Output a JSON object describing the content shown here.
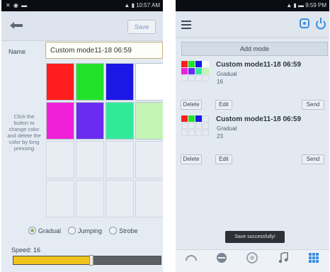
{
  "left_screen": {
    "status_time": "10:57 AM",
    "save_label": "Save",
    "name_label": "Name",
    "name_value": "Custom mode11-18 06:59",
    "hint_text": "Click the button to change color and delete the color by long pressing",
    "color_grid": [
      "#ff1d1d",
      "#22e22a",
      "#1c16e6",
      "#ffffff",
      "#f020d8",
      "#6a2cf0",
      "#30ea9a",
      "#c4f5b4",
      "",
      "",
      "",
      "",
      "",
      "",
      "",
      ""
    ],
    "modes": [
      {
        "label": "Gradual",
        "selected": true
      },
      {
        "label": "Jumping",
        "selected": false
      },
      {
        "label": "Strobe",
        "selected": false
      }
    ],
    "speed_label": "Speed: 16",
    "speed_fraction": 0.53
  },
  "right_screen": {
    "status_time": "9:59 PM",
    "add_mode_label": "Add mode",
    "items": [
      {
        "title": "Custom mode11-18 06:59",
        "type": "Gradual",
        "speed": "16",
        "delete_label": "Delete",
        "edit_label": "Edit",
        "send_label": "Send",
        "colors": [
          "#ff1d1d",
          "#22e22a",
          "#1c16e6",
          "#ffffff",
          "#f020d8",
          "#6a2cf0",
          "#30ea9a",
          "#c4f5b4"
        ]
      },
      {
        "title": "Custom mode11-18 06:59",
        "type": "Gradual",
        "speed": "23",
        "delete_label": "Delete",
        "edit_label": "Edit",
        "send_label": "Send",
        "colors": [
          "#ff1d1d",
          "#22e22a",
          "#1c16e6"
        ]
      }
    ],
    "toast": "Save successfully!",
    "nav_labels": [
      "",
      "",
      "",
      "",
      ""
    ],
    "accent": "#3a8fe0"
  }
}
